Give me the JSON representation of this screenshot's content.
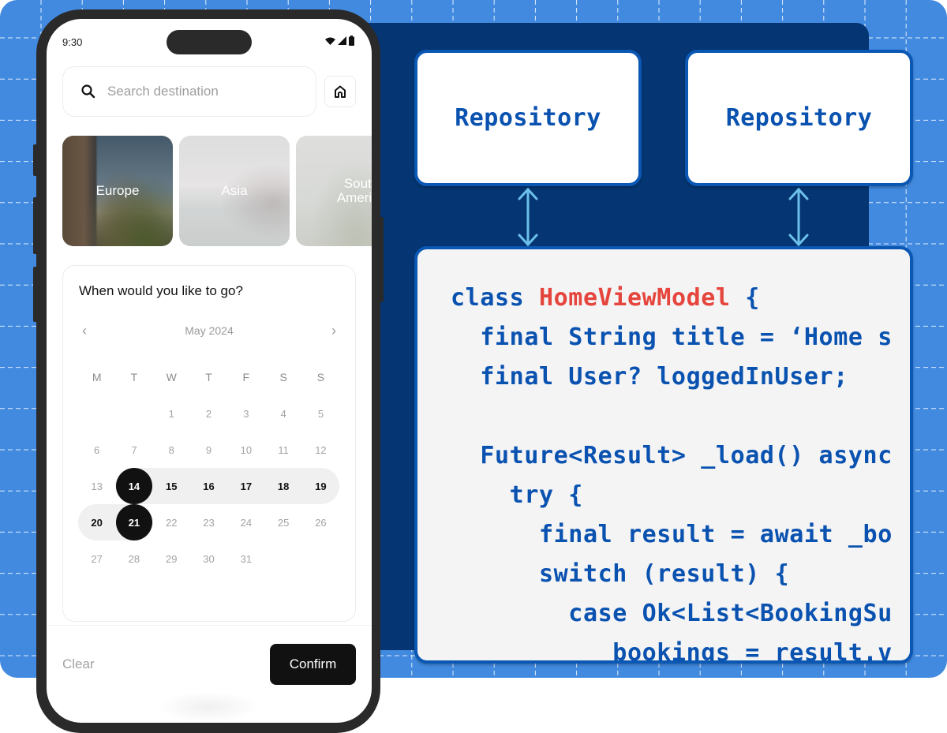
{
  "background": {
    "grid_color": "#ffffff",
    "primary_blue": "#418ae0",
    "navy": "#053673",
    "accent_blue": "#0a52b0",
    "code_highlight_red": "#e5453c"
  },
  "diagram": {
    "repositories": [
      {
        "label": "Repository"
      },
      {
        "label": "Repository"
      }
    ],
    "arrows": [
      {
        "from": "Repository",
        "to": "HomeViewModel",
        "type": "bidirectional"
      },
      {
        "from": "Repository",
        "to": "HomeViewModel",
        "type": "bidirectional"
      }
    ],
    "code": {
      "lines": [
        {
          "indent": "",
          "parts": [
            {
              "text": "class ",
              "style": "normal"
            },
            {
              "text": "HomeViewModel",
              "style": "red"
            },
            {
              "text": " {",
              "style": "normal"
            }
          ]
        },
        {
          "indent": "  ",
          "parts": [
            {
              "text": "final String title = ‘Home s",
              "style": "normal"
            }
          ]
        },
        {
          "indent": "  ",
          "parts": [
            {
              "text": "final User? loggedInUser;",
              "style": "normal"
            }
          ]
        },
        {
          "indent": "",
          "parts": [
            {
              "text": "",
              "style": "normal"
            }
          ]
        },
        {
          "indent": "  ",
          "parts": [
            {
              "text": "Future<Result> _load() async",
              "style": "normal"
            }
          ]
        },
        {
          "indent": "    ",
          "parts": [
            {
              "text": "try {",
              "style": "normal"
            }
          ]
        },
        {
          "indent": "      ",
          "parts": [
            {
              "text": "final result = await _bo",
              "style": "normal"
            }
          ]
        },
        {
          "indent": "      ",
          "parts": [
            {
              "text": "switch (result) {",
              "style": "normal"
            }
          ]
        },
        {
          "indent": "        ",
          "parts": [
            {
              "text": "case Ok<List<BookingSu",
              "style": "normal"
            }
          ]
        },
        {
          "indent": "           ",
          "parts": [
            {
              "text": "bookings = result.v",
              "style": "normal"
            }
          ]
        }
      ]
    }
  },
  "phone": {
    "status_bar": {
      "time": "9:30",
      "icons": [
        "wifi-icon",
        "cellular-signal-icon",
        "battery-icon"
      ]
    },
    "search": {
      "placeholder": "Search destination",
      "value": "",
      "icon": "search-icon"
    },
    "home_button": {
      "icon": "home-icon"
    },
    "destinations": [
      {
        "label": "Europe",
        "state": "selected"
      },
      {
        "label": "Asia",
        "state": "dimmed"
      },
      {
        "label": "South America",
        "state": "dimmed"
      }
    ],
    "calendar": {
      "title": "When would you like to go?",
      "month": "May 2024",
      "prev_icon": "‹",
      "next_icon": "›",
      "weekdays": [
        "M",
        "T",
        "W",
        "T",
        "F",
        "S",
        "S"
      ],
      "weeks": [
        [
          "",
          "",
          "1",
          "2",
          "3",
          "4",
          "5"
        ],
        [
          "6",
          "7",
          "8",
          "9",
          "10",
          "11",
          "12"
        ],
        [
          "13",
          "14",
          "15",
          "16",
          "17",
          "18",
          "19"
        ],
        [
          "20",
          "21",
          "22",
          "23",
          "24",
          "25",
          "26"
        ],
        [
          "27",
          "28",
          "29",
          "30",
          "31",
          "",
          ""
        ]
      ],
      "range_start": "14",
      "range_end": "21"
    },
    "actions": {
      "clear_label": "Clear",
      "confirm_label": "Confirm"
    }
  }
}
